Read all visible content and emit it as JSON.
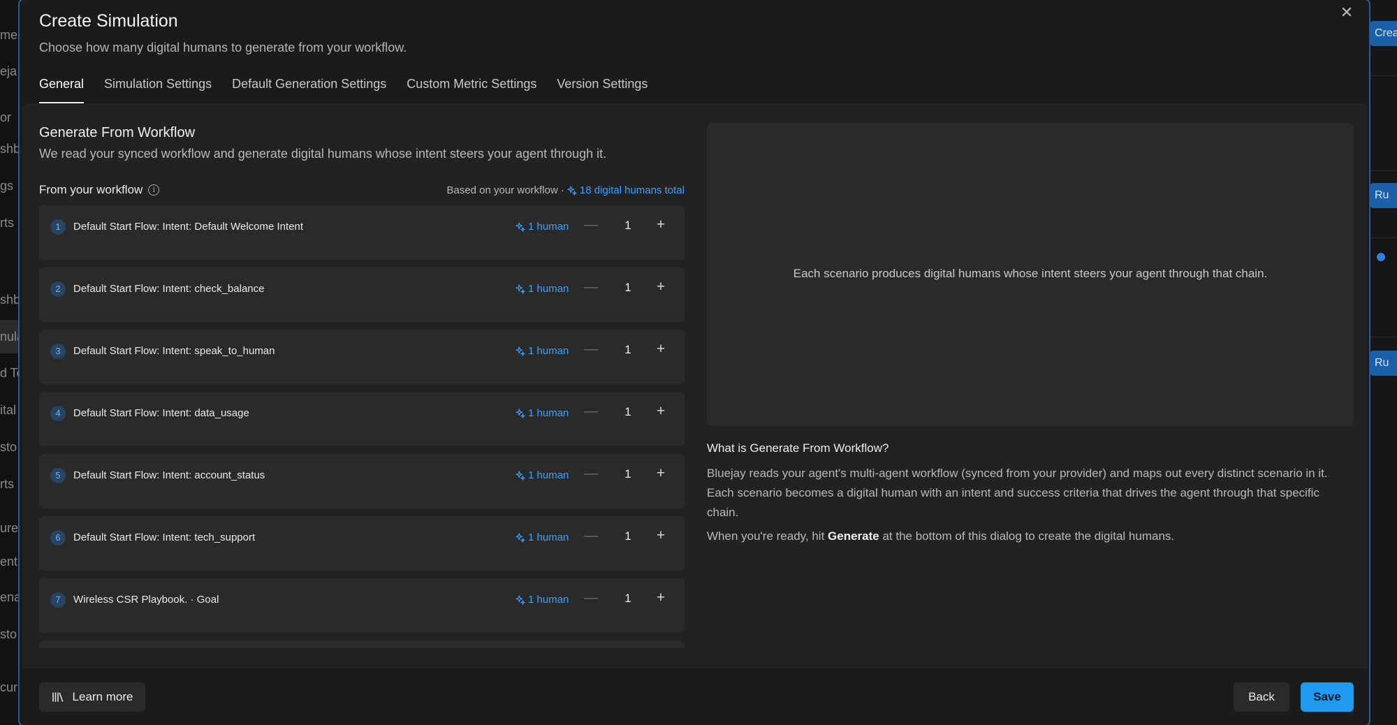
{
  "background": {
    "left_fragments": [
      "me",
      "eja",
      "or",
      "shb",
      "gs",
      "rts",
      "shb",
      "nula",
      "d Te",
      "ital",
      "sto",
      "rts",
      "ure",
      "ent",
      "ena",
      "sto",
      "cur"
    ],
    "right_create": "Creat",
    "right_run_1": "Ru",
    "right_run_2": "Ru"
  },
  "modal": {
    "title": "Create Simulation",
    "subtitle": "Choose how many digital humans to generate from your workflow.",
    "close_icon": "close-icon",
    "tabs": [
      {
        "label": "General"
      },
      {
        "label": "Simulation Settings"
      },
      {
        "label": "Default Generation Settings"
      },
      {
        "label": "Custom Metric Settings"
      },
      {
        "label": "Version Settings"
      }
    ]
  },
  "general": {
    "section_title": "Generate From Workflow",
    "section_desc": "We read your synced workflow and generate digital humans whose intent steers your agent through it.",
    "workflow_label": "From your workflow",
    "based_on": "Based on your workflow ·",
    "total": "18 digital humans total",
    "accent_color": "#3ea2ff",
    "rows": [
      {
        "num": "1",
        "label": "Default Start Flow: Intent: Default Welcome Intent",
        "humans": "1 human",
        "count": "1"
      },
      {
        "num": "2",
        "label": "Default Start Flow: Intent: check_balance",
        "humans": "1 human",
        "count": "1"
      },
      {
        "num": "3",
        "label": "Default Start Flow: Intent: speak_to_human",
        "humans": "1 human",
        "count": "1"
      },
      {
        "num": "4",
        "label": "Default Start Flow: Intent: data_usage",
        "humans": "1 human",
        "count": "1"
      },
      {
        "num": "5",
        "label": "Default Start Flow: Intent: account_status",
        "humans": "1 human",
        "count": "1"
      },
      {
        "num": "6",
        "label": "Default Start Flow: Intent: tech_support",
        "humans": "1 human",
        "count": "1"
      },
      {
        "num": "7",
        "label": "Wireless CSR Playbook. · Goal",
        "humans": "1 human",
        "count": "1"
      }
    ],
    "preview_text": "Each scenario produces digital humans whose intent steers your agent through that chain.",
    "help_title": "What is Generate From Workflow?",
    "help_body": "Bluejay reads your agent's multi-agent workflow (synced from your provider) and maps out every distinct scenario in it. Each scenario becomes a digital human with an intent and success criteria that drives the agent through that specific chain.",
    "help_body2_pre": "When you're ready, hit ",
    "help_body2_bold": "Generate",
    "help_body2_post": " at the bottom of this dialog to create the digital humans."
  },
  "footer": {
    "learn_more": "Learn more",
    "back": "Back",
    "save": "Save",
    "save_color": "#1e9bf0"
  }
}
